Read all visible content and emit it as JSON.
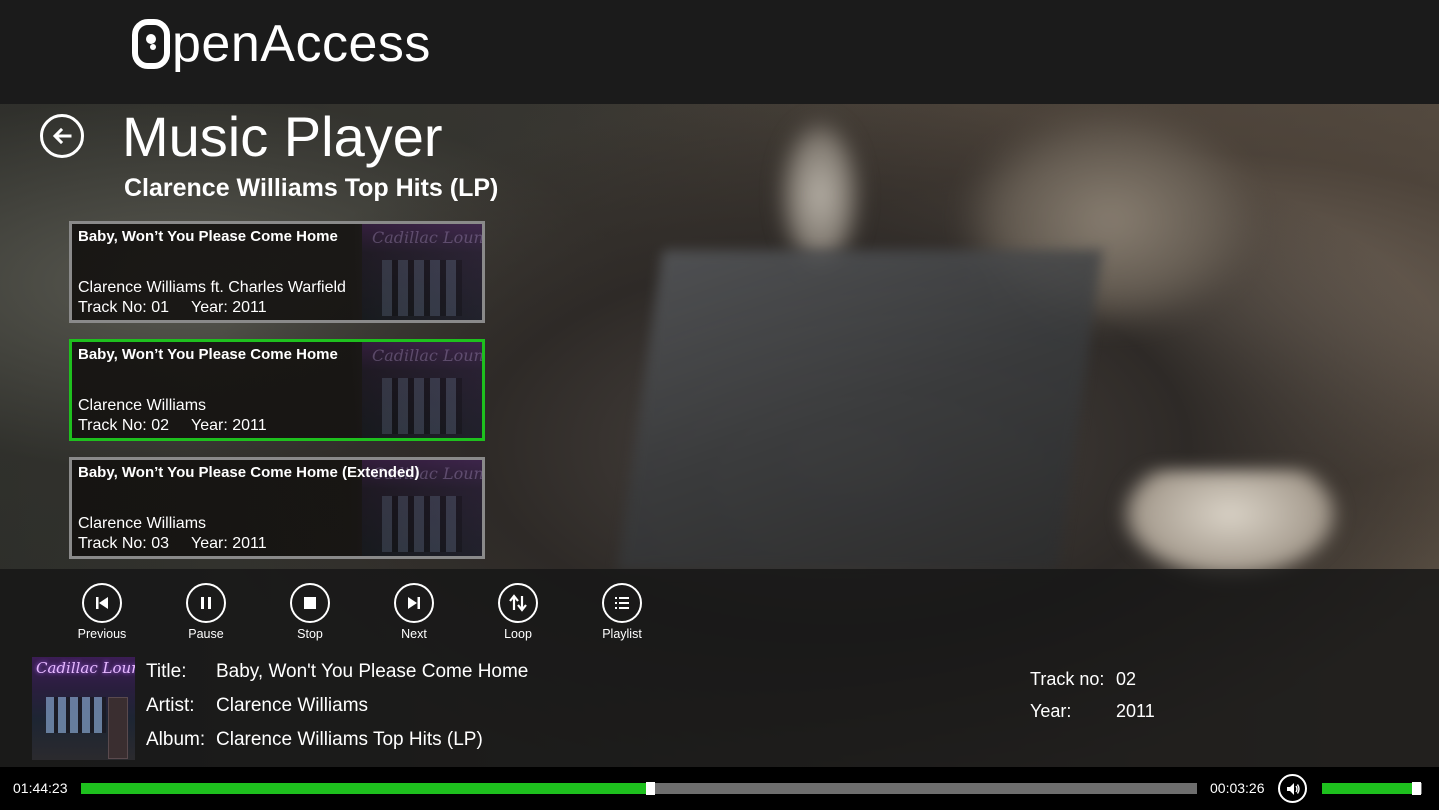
{
  "app": {
    "logo_first": "O",
    "logo_rest": "pen",
    "logo_second": "Access"
  },
  "page": {
    "title": "Music Player",
    "subtitle": "Clarence Williams Top Hits (LP)"
  },
  "tracks": [
    {
      "title": "Baby, Won’t You Please Come Home",
      "artist": "Clarence Williams ft. Charles Warfield",
      "track_label": "Track No: 01",
      "year_label": "Year: 2011",
      "selected": false
    },
    {
      "title": "Baby, Won’t You Please Come Home",
      "artist": "Clarence Williams",
      "track_label": "Track No: 02",
      "year_label": "Year: 2011",
      "selected": true
    },
    {
      "title": "Baby, Won’t You Please Come Home (Extended)",
      "artist": "Clarence Williams",
      "track_label": "Track No: 03",
      "year_label": "Year: 2011",
      "selected": false
    }
  ],
  "album_art_text": "Cadillac Lounge",
  "controls": {
    "previous": "Previous",
    "pause": "Pause",
    "stop": "Stop",
    "next": "Next",
    "loop": "Loop",
    "playlist": "Playlist"
  },
  "now_playing": {
    "title_label": "Title:",
    "title": "Baby, Won't You Please Come Home",
    "artist_label": "Artist:",
    "artist": "Clarence Williams",
    "album_label": "Album:",
    "album": "Clarence Williams Top Hits (LP)",
    "track_no_label": "Track no:",
    "track_no": "02",
    "year_label": "Year:",
    "year": "2011"
  },
  "playback": {
    "elapsed": "01:44:23",
    "total": "00:03:26",
    "progress": 0.51,
    "volume": 0.95
  },
  "colors": {
    "accent": "#1ec01e",
    "track_bg": "#6e6e6e"
  }
}
